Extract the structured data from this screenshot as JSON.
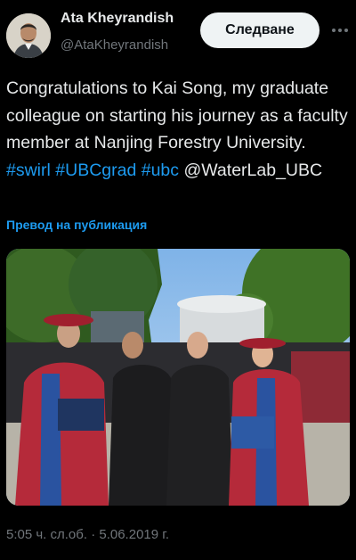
{
  "author": {
    "display_name": "Ata Kheyrandish",
    "handle": "@AtaKheyrandish"
  },
  "follow_button_label": "Следване",
  "icons": {
    "more": "more-horizontal-icon",
    "avatar": "profile-photo"
  },
  "tweet": {
    "text_before_links": "Congratulations to Kai Song, my graduate colleague on starting his journey as a faculty member at Nanjing Forestry University.",
    "hashtag_swirl": "#swirl",
    "hashtag_ubcgrad": "#UBCgrad",
    "hashtag_ubc": "#ubc",
    "mention": "@WaterLab_UBC",
    "translate_label": "Превод на публикация"
  },
  "timestamp": "5:05 ч. сл.об. · 5.06.2019 г.",
  "colors": {
    "background": "#000000",
    "text": "#e7e9ea",
    "secondary_text": "#71767b",
    "link": "#1d9bf0",
    "follow_button_bg": "#eff3f4"
  }
}
